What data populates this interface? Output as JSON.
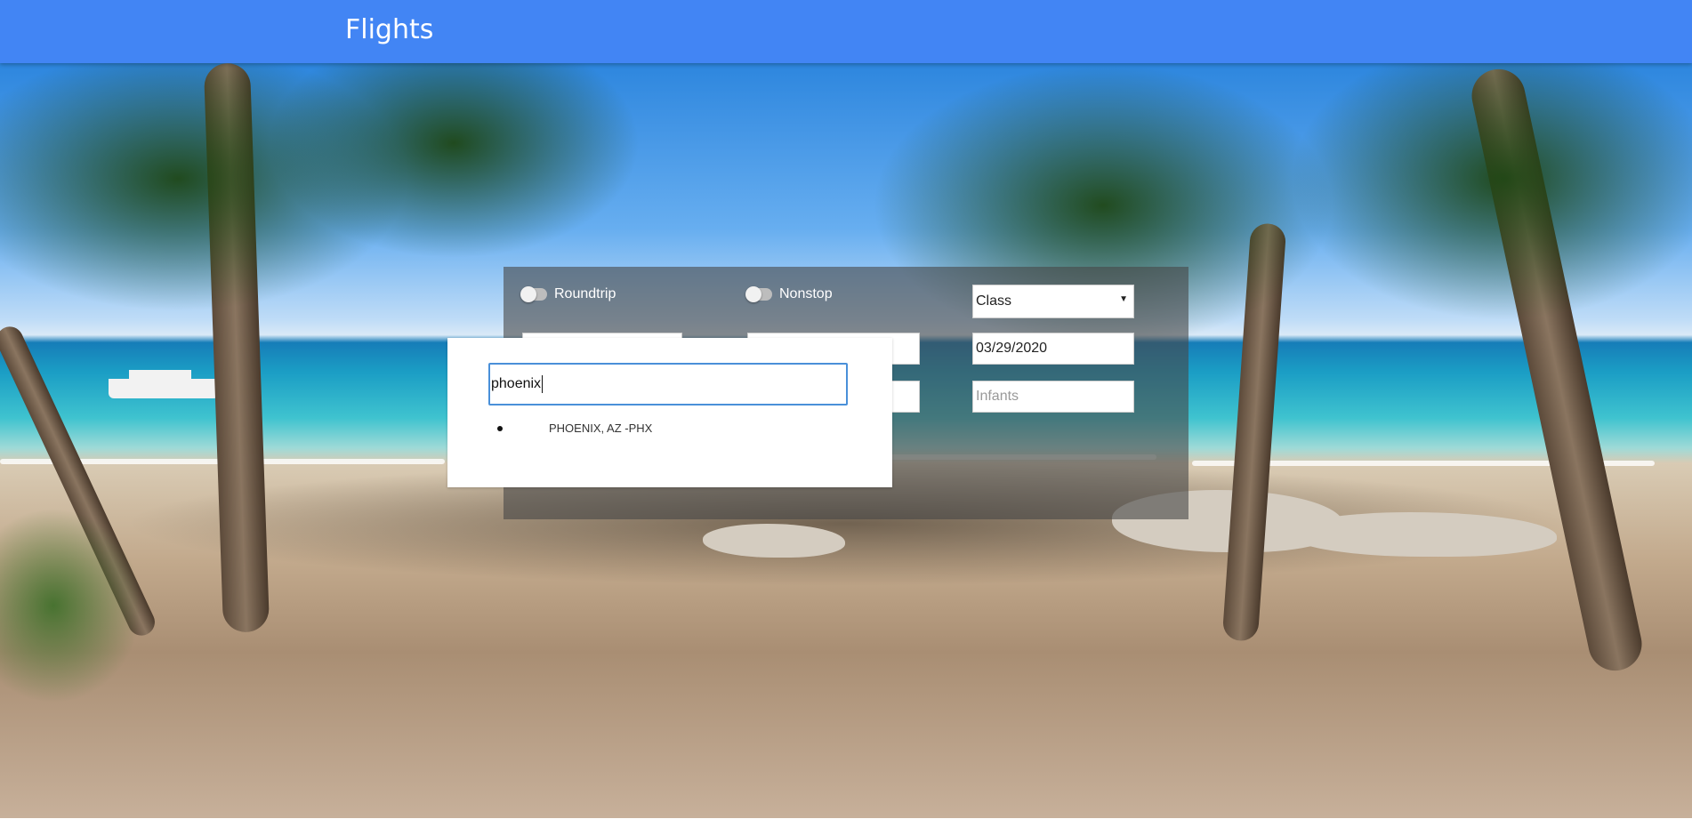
{
  "header": {
    "title": "Flights"
  },
  "search": {
    "roundtrip_label": "Roundtrip",
    "nonstop_label": "Nonstop",
    "class_select": "Class",
    "date_value": "03/29/2020",
    "infants_placeholder": "Infants"
  },
  "airport_popup": {
    "input_value": "phoenix",
    "suggestions": [
      {
        "label": "PHOENIX, AZ -PHX"
      }
    ]
  },
  "colors": {
    "header_bg": "#4285f4",
    "panel_bg": "#464646",
    "focus_border": "#4a90d9"
  }
}
